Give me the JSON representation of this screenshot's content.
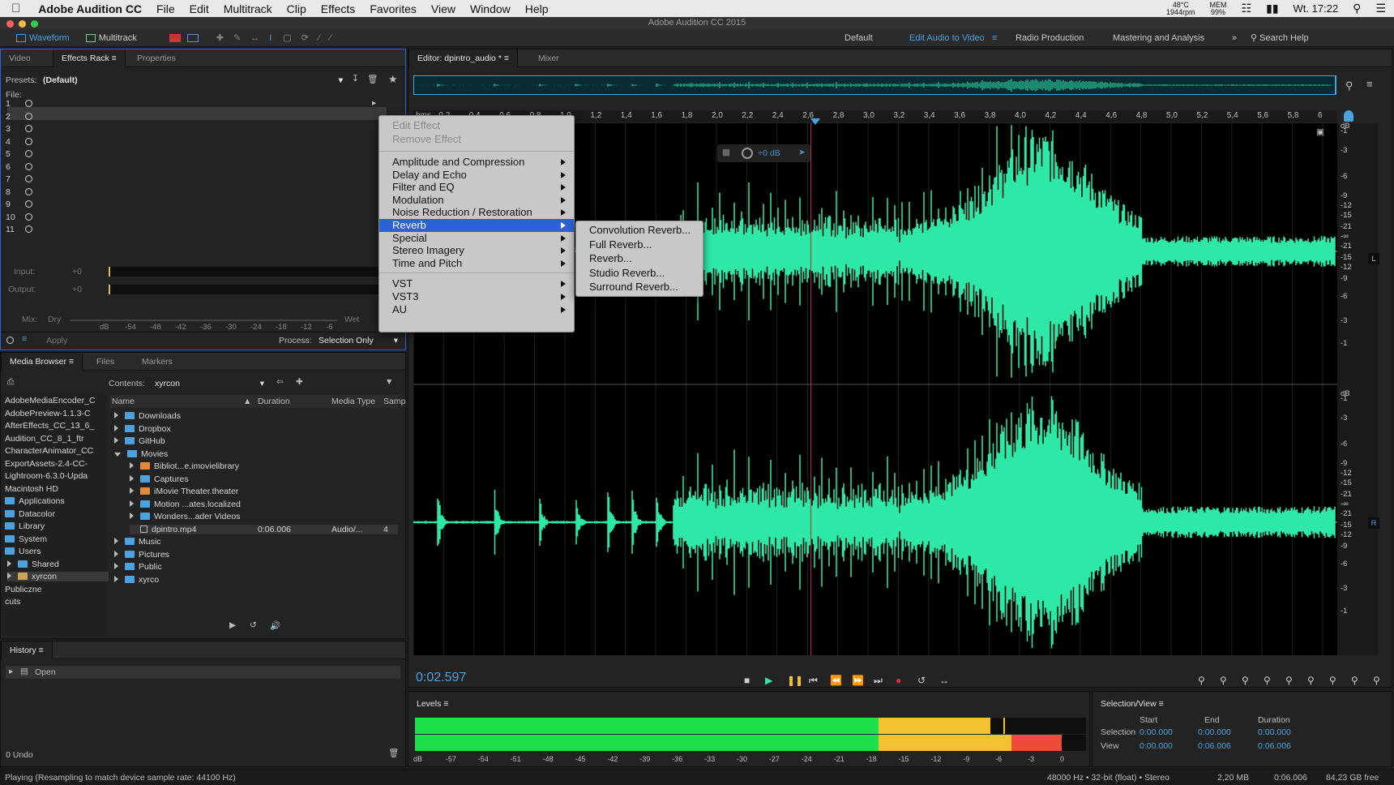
{
  "mac": {
    "app": "Adobe Audition CC",
    "menus": [
      "File",
      "Edit",
      "Multitrack",
      "Clip",
      "Effects",
      "Favorites",
      "View",
      "Window",
      "Help"
    ],
    "status": {
      "cpu": "48°C",
      "rpm": "1944rpm",
      "mem": "MEM",
      "mempct": "99%",
      "clock": "Wt. 17:22"
    }
  },
  "window_title": "Adobe Audition CC 2015",
  "toolbar": {
    "waveform": "Waveform",
    "multitrack": "Multitrack"
  },
  "workspaces": [
    "Default",
    "Edit Audio to Video",
    "Radio Production",
    "Mastering and Analysis"
  ],
  "search_help": "Search Help",
  "left_tabs": [
    "Video",
    "Effects Rack",
    "Properties"
  ],
  "effects_rack": {
    "presets_label": "Presets:",
    "presets_value": "(Default)",
    "file_label": "File:",
    "slots": [
      "1",
      "2",
      "3",
      "4",
      "5",
      "6",
      "7",
      "8",
      "9",
      "10",
      "11"
    ],
    "input_label": "Input:",
    "output_label": "Output:",
    "input_val": "+0",
    "output_val": "+0",
    "db_scale": [
      "dB",
      "-54",
      "-48",
      "-42",
      "-36",
      "-30",
      "-24",
      "-18",
      "-12",
      "-6"
    ],
    "mix_label": "Mix:",
    "dry": "Dry",
    "wet": "Wet",
    "apply": "Apply",
    "process_label": "Process:",
    "process_value": "Selection Only"
  },
  "media_tabs": [
    "Media Browser",
    "Files",
    "Markers"
  ],
  "media": {
    "contents_label": "Contents:",
    "contents_value": "xyrcon",
    "columns": [
      "Name",
      "Duration",
      "Media Type",
      "Samp"
    ],
    "left_list": [
      "AdobeMediaEncoder_C",
      "AdobePreview-1.1.3-C",
      "AfterEffects_CC_13_6_",
      "Audition_CC_8_1_ftr",
      "CharacterAnimator_CC",
      "ExportAssets-2.4-CC-",
      "Lightroom-6.3.0-Upda",
      "Macintosh HD",
      "Applications",
      "Datacolor",
      "Library",
      "System",
      "Users",
      "Shared",
      "xyrcon",
      "Publiczne",
      "cuts"
    ],
    "tree": [
      {
        "name": "Downloads",
        "depth": 0
      },
      {
        "name": "Dropbox",
        "depth": 0
      },
      {
        "name": "GitHub",
        "depth": 0
      },
      {
        "name": "Movies",
        "depth": 0,
        "open": true
      },
      {
        "name": "Bibliot...e.imovielibrary",
        "depth": 1
      },
      {
        "name": "Captures",
        "depth": 1
      },
      {
        "name": "iMovie Theater.theater",
        "depth": 1
      },
      {
        "name": "Motion ...ates.localized",
        "depth": 1
      },
      {
        "name": "Wonders...ader Videos",
        "depth": 1
      },
      {
        "name": "dpintro.mp4",
        "depth": 1,
        "file": true,
        "duration": "0:06.006",
        "type": "Audio/...",
        "samp": "4"
      },
      {
        "name": "Music",
        "depth": 0
      },
      {
        "name": "Pictures",
        "depth": 0
      },
      {
        "name": "Public",
        "depth": 0
      },
      {
        "name": "xyrco",
        "depth": 0
      }
    ]
  },
  "history": {
    "title": "History",
    "item": "Open",
    "undo": "0 Undo"
  },
  "editor_tabs": [
    "Editor: dpintro_audio *",
    "Mixer"
  ],
  "ruler": [
    "hms",
    "0,2",
    "0,4",
    "0,6",
    "0,8",
    "1,0",
    "1,2",
    "1,4",
    "1,6",
    "1,8",
    "2,0",
    "2,2",
    "2,4",
    "2,6",
    "2,8",
    "3,0",
    "3,2",
    "3,4",
    "3,6",
    "3,8",
    "4,0",
    "4,2",
    "4,4",
    "4,6",
    "4,8",
    "5,0",
    "5,2",
    "5,4",
    "5,6",
    "5,8",
    "6"
  ],
  "hud": "+0 dB",
  "db_right": [
    "dB",
    "-1",
    "-3",
    "-6",
    "-9",
    "-12",
    "-15",
    "-21",
    "-∞",
    "-21",
    "-15",
    "-12",
    "-9",
    "-6",
    "-3",
    "-1"
  ],
  "ch_left": "L",
  "ch_right": "R",
  "context_menu": {
    "disabled": [
      "Edit Effect",
      "Remove Effect"
    ],
    "groups": [
      "Amplitude and Compression",
      "Delay and Echo",
      "Filter and EQ",
      "Modulation",
      "Noise Reduction / Restoration",
      "Reverb",
      "Special",
      "Stereo Imagery",
      "Time and Pitch"
    ],
    "plugins": [
      "VST",
      "VST3",
      "AU"
    ],
    "highlighted": "Reverb"
  },
  "submenu": [
    "Convolution Reverb...",
    "Full Reverb...",
    "Reverb...",
    "Studio Reverb...",
    "Surround Reverb..."
  ],
  "time": "0:02.597",
  "levels": {
    "title": "Levels",
    "scale": [
      "dB",
      "-57",
      "-54",
      "-51",
      "-48",
      "-45",
      "-42",
      "-39",
      "-36",
      "-33",
      "-30",
      "-27",
      "-24",
      "-21",
      "-18",
      "-15",
      "-12",
      "-9",
      "-6",
      "-3",
      "0"
    ]
  },
  "selection_view": {
    "title": "Selection/View",
    "cols": [
      "Start",
      "End",
      "Duration"
    ],
    "selection_label": "Selection",
    "view_label": "View",
    "selection": [
      "0:00.000",
      "0:00.000",
      "0:00.000"
    ],
    "view": [
      "0:00.000",
      "0:06.006",
      "0:06.006"
    ]
  },
  "status": {
    "left": "Playing (Resampling to match device sample rate: 44100 Hz)",
    "format": "48000 Hz • 32-bit (float) • Stereo",
    "size": "2,20 MB",
    "dur": "0:06.006",
    "free": "84,23 GB free"
  },
  "colors": {
    "wave": "#2ee8a8",
    "accent": "#4aa3df",
    "menu_hl": "#2a63d6"
  }
}
